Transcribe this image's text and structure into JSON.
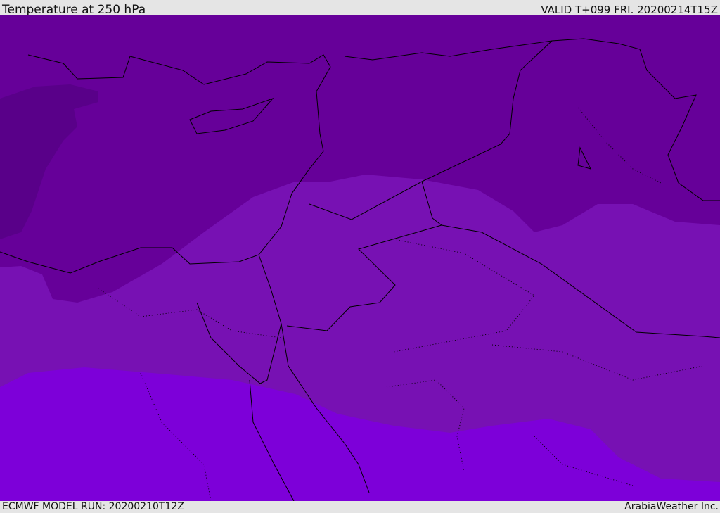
{
  "header": {
    "title": "Temperature at 250 hPa",
    "valid": "VALID T+099 FRI. 20200214T15Z"
  },
  "footer": {
    "model_run": "ECMWF MODEL RUN: 20200210T12Z",
    "credit": "ArabiaWeather Inc."
  },
  "colors": {
    "coldest": "#590089",
    "cold": "#660099",
    "mid": "#7711b3",
    "warm": "#7d00d9",
    "coast": "#000000"
  }
}
